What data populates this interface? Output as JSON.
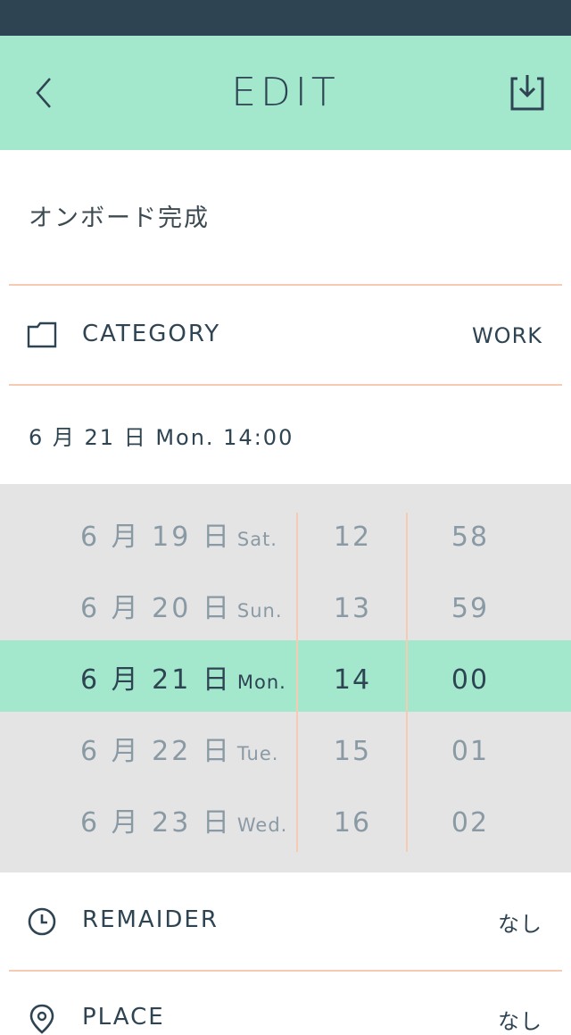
{
  "nav": {
    "title": "EDIT",
    "back_icon": "chevron-left-icon",
    "save_icon": "save-download-icon"
  },
  "task": {
    "title": "オンボード完成"
  },
  "category": {
    "label": "CATEGORY",
    "value": "WORK",
    "icon": "folder-icon"
  },
  "datetime": {
    "summary": "6 月 21 日 Mon. 14:00"
  },
  "picker": {
    "rows": [
      {
        "date": "6 月 19 日",
        "dow": "Sat.",
        "hour": "12",
        "minute": "58"
      },
      {
        "date": "6 月 20 日",
        "dow": "Sun.",
        "hour": "13",
        "minute": "59"
      },
      {
        "date": "6 月 21 日",
        "dow": "Mon.",
        "hour": "14",
        "minute": "00"
      },
      {
        "date": "6 月 22 日",
        "dow": "Tue.",
        "hour": "15",
        "minute": "01"
      },
      {
        "date": "6 月 23 日",
        "dow": "Wed.",
        "hour": "16",
        "minute": "02"
      }
    ],
    "selected_index": 2
  },
  "reminder": {
    "label": "REMAIDER",
    "value": "なし",
    "icon": "clock-icon"
  },
  "place": {
    "label": "PLACE",
    "value": "なし",
    "icon": "location-pin-icon"
  },
  "colors": {
    "accent": "#a3e8cd",
    "status_bar": "#2e4452",
    "divider": "#f6cbb3",
    "picker_bg": "#e4e4e4"
  }
}
